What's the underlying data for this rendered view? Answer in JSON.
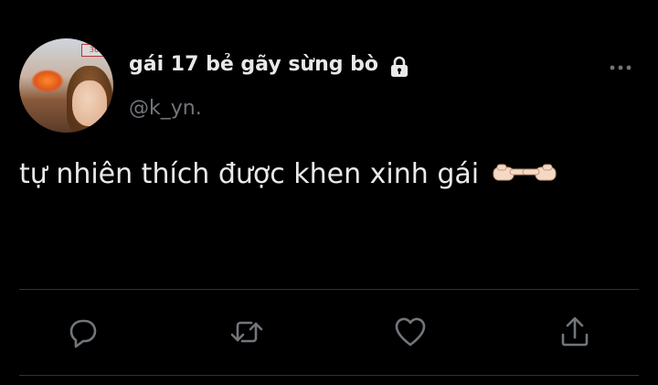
{
  "tweet": {
    "display_name": "gái 17 bẻ gãy sừng bò",
    "handle": "@k_yn.",
    "text": "tự nhiên thích được khen xinh gái",
    "emoji": "👉🏻👈🏻",
    "avatar_sign": "36"
  },
  "icons": {
    "lock": "lock-icon",
    "more": "more-icon",
    "reply": "reply-icon",
    "retweet": "retweet-icon",
    "like": "heart-icon",
    "share": "share-icon"
  },
  "colors": {
    "background": "#000000",
    "text": "#e7e9ea",
    "secondary": "#71767b",
    "icon": "#71767b",
    "divider": "#2f3336"
  }
}
